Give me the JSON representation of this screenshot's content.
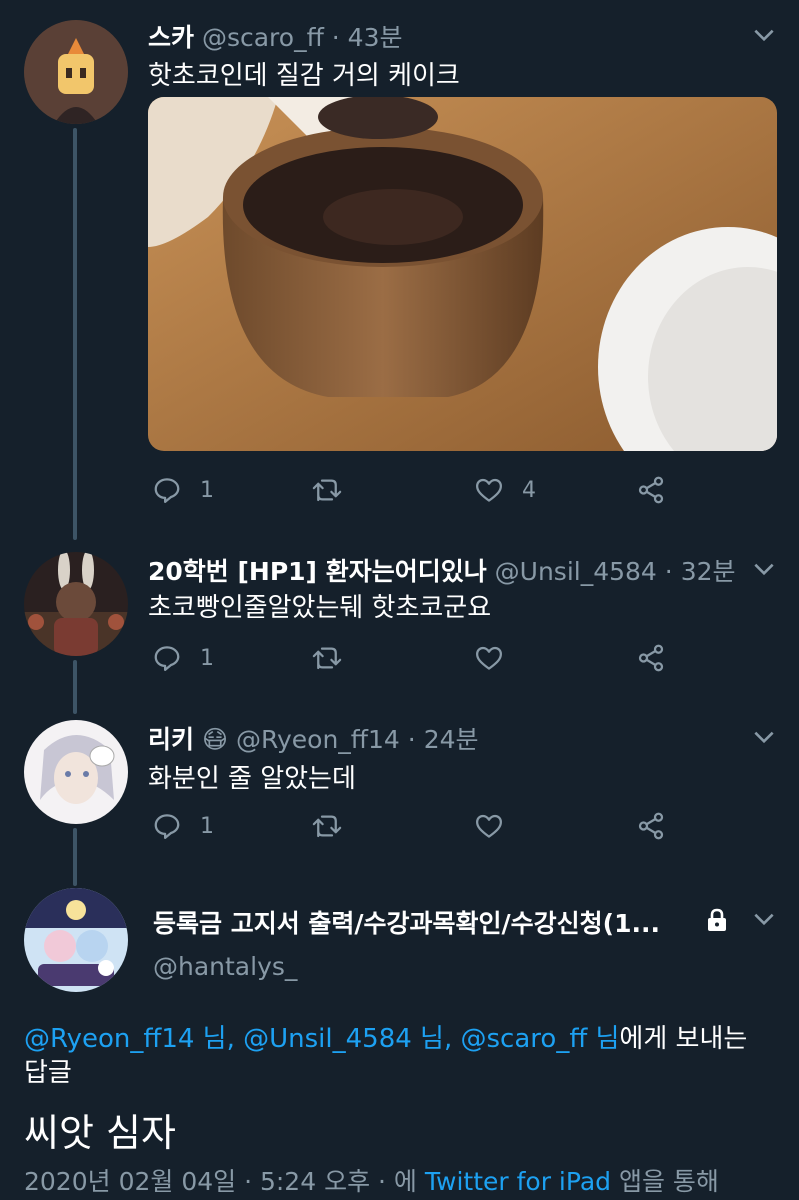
{
  "tweets": [
    {
      "name": "스카",
      "handle": "@scaro_ff",
      "time": "· 43분",
      "text": "핫초코인데 질감 거의 케이크",
      "replies": "1",
      "likes": "4"
    },
    {
      "name": "20학번 [HP1] 환자는어디있나",
      "handle": "@Unsil_4584",
      "time": "· 32분",
      "text": "초코빵인줄알았는뒈 핫초코군요",
      "replies": "1",
      "likes": ""
    },
    {
      "name": "리키",
      "emoji": "😷",
      "handle": "@Ryeon_ff14",
      "time": "· 24분",
      "text": "화분인 줄 알았는데",
      "replies": "1",
      "likes": ""
    }
  ],
  "main_tweet": {
    "name": "등록금 고지서 출력/수강과목확인/수강신청(1...",
    "handle": "@hantalys_",
    "reply_to": {
      "mention1": "@Ryeon_ff14 님,",
      "mention2": "@Unsil_4584 님,",
      "mention3": "@scaro_ff 님",
      "suffix": "에게 보내는",
      "line2": "답글"
    },
    "text": "씨앗 심자",
    "meta": {
      "datetime": "2020년 02월 04일 · 5:24 오후 · 에",
      "client": "Twitter for iPad",
      "suffix": "앱을 통해"
    }
  },
  "colors": {
    "background": "#15202b",
    "secondary_text": "#8899a6",
    "link": "#1da1f2",
    "thread_line": "#3d5466"
  },
  "icons": [
    "reply-icon",
    "retweet-icon",
    "like-icon",
    "share-icon",
    "chevron-down-icon",
    "lock-icon"
  ]
}
